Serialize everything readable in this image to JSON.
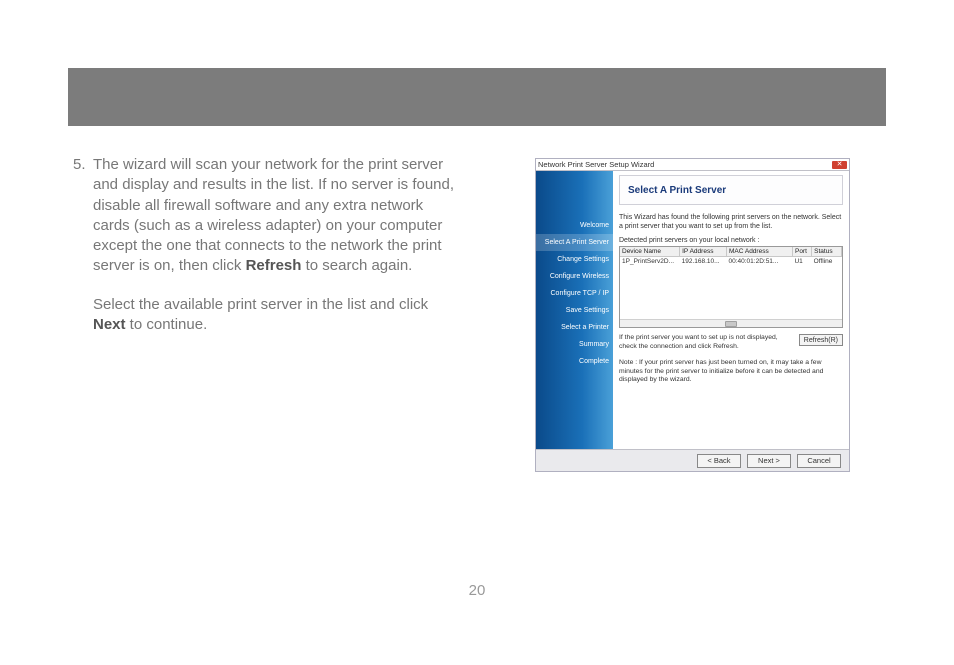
{
  "doc": {
    "list_number": "5.",
    "para1_a": "The wizard will scan your network for the print server and display and results in the list.  If no server is found, disable all firewall software and any extra network cards (such as a wireless adapter) on your computer except the one that connects to the network the print server is on, then click ",
    "refresh_word": "Refresh",
    "para1_b": " to search again.",
    "para2_a": "Select the available print server in the list and click ",
    "next_word": "Next",
    "para2_b": " to continue.",
    "page_number": "20"
  },
  "wizard": {
    "title": "Network Print Server Setup Wizard",
    "close_glyph": "✕",
    "sidebar": {
      "items": [
        {
          "label": "Welcome"
        },
        {
          "label": "Select A Print Server"
        },
        {
          "label": "Change Settings"
        },
        {
          "label": "Configure Wireless"
        },
        {
          "label": "Configure TCP / IP"
        },
        {
          "label": "Save Settings"
        },
        {
          "label": "Select a Printer"
        },
        {
          "label": "Summary"
        },
        {
          "label": "Complete"
        }
      ],
      "selected_index": 1
    },
    "header_title": "Select A Print Server",
    "description": "This Wizard has found the following print servers on the network. Select a print server that you want to set up from the list.",
    "detected_label": "Detected print servers on your local network :",
    "table": {
      "headers": {
        "device": "Device Name",
        "ip": "IP Address",
        "mac": "MAC Address",
        "port": "Port",
        "status": "Status"
      },
      "rows": [
        {
          "device": "1P_PrintServ2D...",
          "ip": "192.168.10...",
          "mac": "00:40:01:2D:51...",
          "port": "U1",
          "status": "Offline"
        }
      ]
    },
    "refresh_hint": "If the print server you want to set up is not displayed, check the connection and click Refresh.",
    "refresh_button": "Refresh(R)",
    "note": "Note : If your print server has just been turned on, it may take a few minutes for the print server to initialize before it can be detected and displayed by the wizard.",
    "buttons": {
      "back": "< Back",
      "next": "Next >",
      "cancel": "Cancel"
    }
  }
}
